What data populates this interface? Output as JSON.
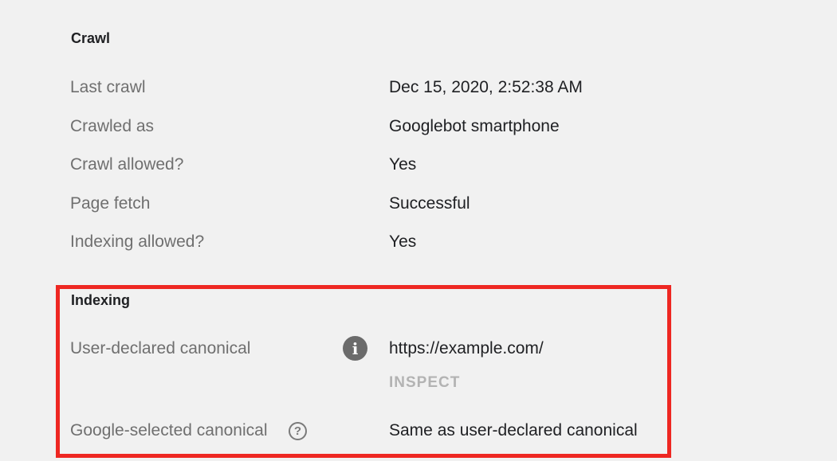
{
  "crawl": {
    "title": "Crawl",
    "rows": [
      {
        "label": "Last crawl",
        "value": "Dec 15, 2020, 2:52:38 AM"
      },
      {
        "label": "Crawled as",
        "value": "Googlebot smartphone"
      },
      {
        "label": "Crawl allowed?",
        "value": "Yes"
      },
      {
        "label": "Page fetch",
        "value": "Successful"
      },
      {
        "label": "Indexing allowed?",
        "value": "Yes"
      }
    ]
  },
  "indexing": {
    "title": "Indexing",
    "user_canonical": {
      "label": "User-declared canonical",
      "value": "https://example.com/",
      "action": "INSPECT",
      "icon": "info-icon"
    },
    "google_canonical": {
      "label": "Google-selected canonical",
      "value": "Same as user-declared canonical",
      "icon": "help-icon"
    }
  },
  "colors": {
    "highlight_border": "#ee2722",
    "label_text": "#6f6f6f",
    "value_text": "#202124",
    "inspect_text": "#b3b3b3"
  }
}
